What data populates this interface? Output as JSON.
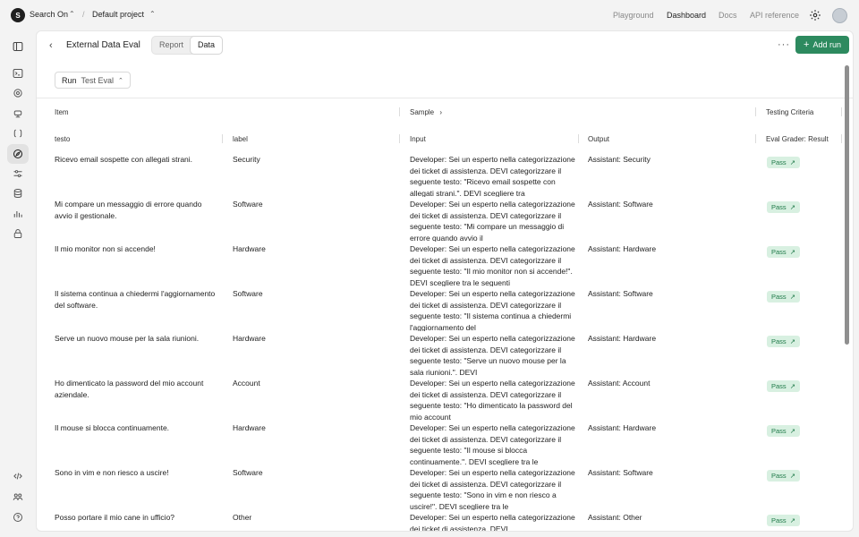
{
  "topbar": {
    "org_initial": "S",
    "org_name": "Search On",
    "project_name": "Default project",
    "links": [
      "Playground",
      "Dashboard",
      "Docs",
      "API reference"
    ],
    "active_link": "Dashboard"
  },
  "header": {
    "title": "External Data Eval",
    "tabs": [
      "Report",
      "Data"
    ],
    "active_tab": "Data",
    "add_run_label": "Add run"
  },
  "run_select": {
    "label": "Run",
    "value": "Test Eval"
  },
  "table": {
    "group_headers": {
      "item": "Item",
      "sample": "Sample",
      "criteria": "Testing Criteria"
    },
    "columns": {
      "testo": "testo",
      "label": "label",
      "input": "Input",
      "output": "Output",
      "grader": "Eval Grader: Result"
    },
    "rows": [
      {
        "testo": "Ricevo email sospette con allegati strani.",
        "label": "Security",
        "input": "Developer: Sei un esperto nella categorizzazione dei ticket di assistenza. DEVI categorizzare il seguente testo: \"Ricevo email sospette con allegati strani.\". DEVI scegliere tra",
        "output": "Assistant: Security",
        "result": "Pass"
      },
      {
        "testo": "Mi compare un messaggio di errore quando avvio il gestionale.",
        "label": "Software",
        "input": "Developer: Sei un esperto nella categorizzazione dei ticket di assistenza. DEVI categorizzare il seguente testo: \"Mi compare un messaggio di errore quando avvio il",
        "output": "Assistant: Software",
        "result": "Pass"
      },
      {
        "testo": "Il mio monitor non si accende!",
        "label": "Hardware",
        "input": "Developer: Sei un esperto nella categorizzazione dei ticket di assistenza. DEVI categorizzare il seguente testo: \"Il mio monitor non si accende!\". DEVI scegliere tra le seguenti",
        "output": "Assistant: Hardware",
        "result": "Pass"
      },
      {
        "testo": "Il sistema continua a chiedermi l'aggiornamento del software.",
        "label": "Software",
        "input": "Developer: Sei un esperto nella categorizzazione dei ticket di assistenza. DEVI categorizzare il seguente testo: \"Il sistema continua a chiedermi l'aggiornamento del",
        "output": "Assistant: Software",
        "result": "Pass"
      },
      {
        "testo": "Serve un nuovo mouse per la sala riunioni.",
        "label": "Hardware",
        "input": "Developer: Sei un esperto nella categorizzazione dei ticket di assistenza. DEVI categorizzare il seguente testo: \"Serve un nuovo mouse per la sala riunioni.\". DEVI",
        "output": "Assistant: Hardware",
        "result": "Pass"
      },
      {
        "testo": "Ho dimenticato la password del mio account aziendale.",
        "label": "Account",
        "input": "Developer: Sei un esperto nella categorizzazione dei ticket di assistenza. DEVI categorizzare il seguente testo: \"Ho dimenticato la password del mio account",
        "output": "Assistant: Account",
        "result": "Pass"
      },
      {
        "testo": "Il mouse si blocca continuamente.",
        "label": "Hardware",
        "input": "Developer: Sei un esperto nella categorizzazione dei ticket di assistenza. DEVI categorizzare il seguente testo: \"Il mouse si blocca continuamente.\". DEVI scegliere tra le",
        "output": "Assistant: Hardware",
        "result": "Pass"
      },
      {
        "testo": "Sono in vim e non riesco a uscire!",
        "label": "Software",
        "input": "Developer: Sei un esperto nella categorizzazione dei ticket di assistenza. DEVI categorizzare il seguente testo: \"Sono in vim e non riesco a uscire!\". DEVI scegliere tra le",
        "output": "Assistant: Software",
        "result": "Pass"
      },
      {
        "testo": "Posso portare il mio cane in ufficio?",
        "label": "Other",
        "input": "Developer: Sei un esperto nella categorizzazione dei ticket di assistenza. DEVI",
        "output": "Assistant: Other",
        "result": "Pass"
      }
    ]
  },
  "colors": {
    "accent": "#2d8a5f",
    "pass_bg": "#d8f0e1",
    "pass_text": "#1f7a49"
  },
  "icons": [
    "sidebar-toggle-icon",
    "terminal-icon",
    "openai-icon",
    "bot-icon",
    "brackets-icon",
    "compass-icon",
    "sliders-icon",
    "database-icon",
    "chart-icon",
    "lock-icon",
    "code-icon",
    "team-icon",
    "help-icon",
    "gear-icon"
  ]
}
